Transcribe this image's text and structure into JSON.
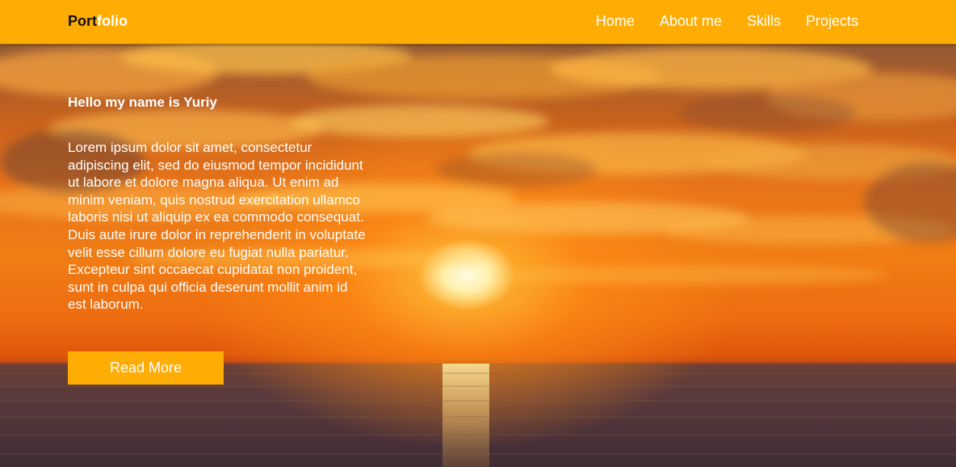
{
  "navbar": {
    "logo": {
      "part1": "Port",
      "part2": "folio"
    },
    "links": [
      {
        "label": "Home"
      },
      {
        "label": "About me"
      },
      {
        "label": "Skills"
      },
      {
        "label": "Projects"
      }
    ]
  },
  "hero": {
    "greeting": "Hello my name is Yuriy",
    "intro": "Lorem ipsum dolor sit amet, consectetur adipiscing elit, sed do eiusmod tempor incididunt ut labore et dolore magna aliqua. Ut enim ad minim veniam, quis nostrud exercitation ullamco laboris nisi ut aliquip ex ea commodo consequat. Duis aute irure dolor in reprehenderit in voluptate velit esse cillum dolore eu fugiat nulla pariatur. Excepteur sint occaecat cupidatat non proident, sunt in culpa qui officia deserunt mollit anim id est laborum.",
    "button_label": "Read More"
  },
  "colors": {
    "accent": "#ffad05",
    "logo_dark": "#111111",
    "text_light": "#ffffff"
  }
}
